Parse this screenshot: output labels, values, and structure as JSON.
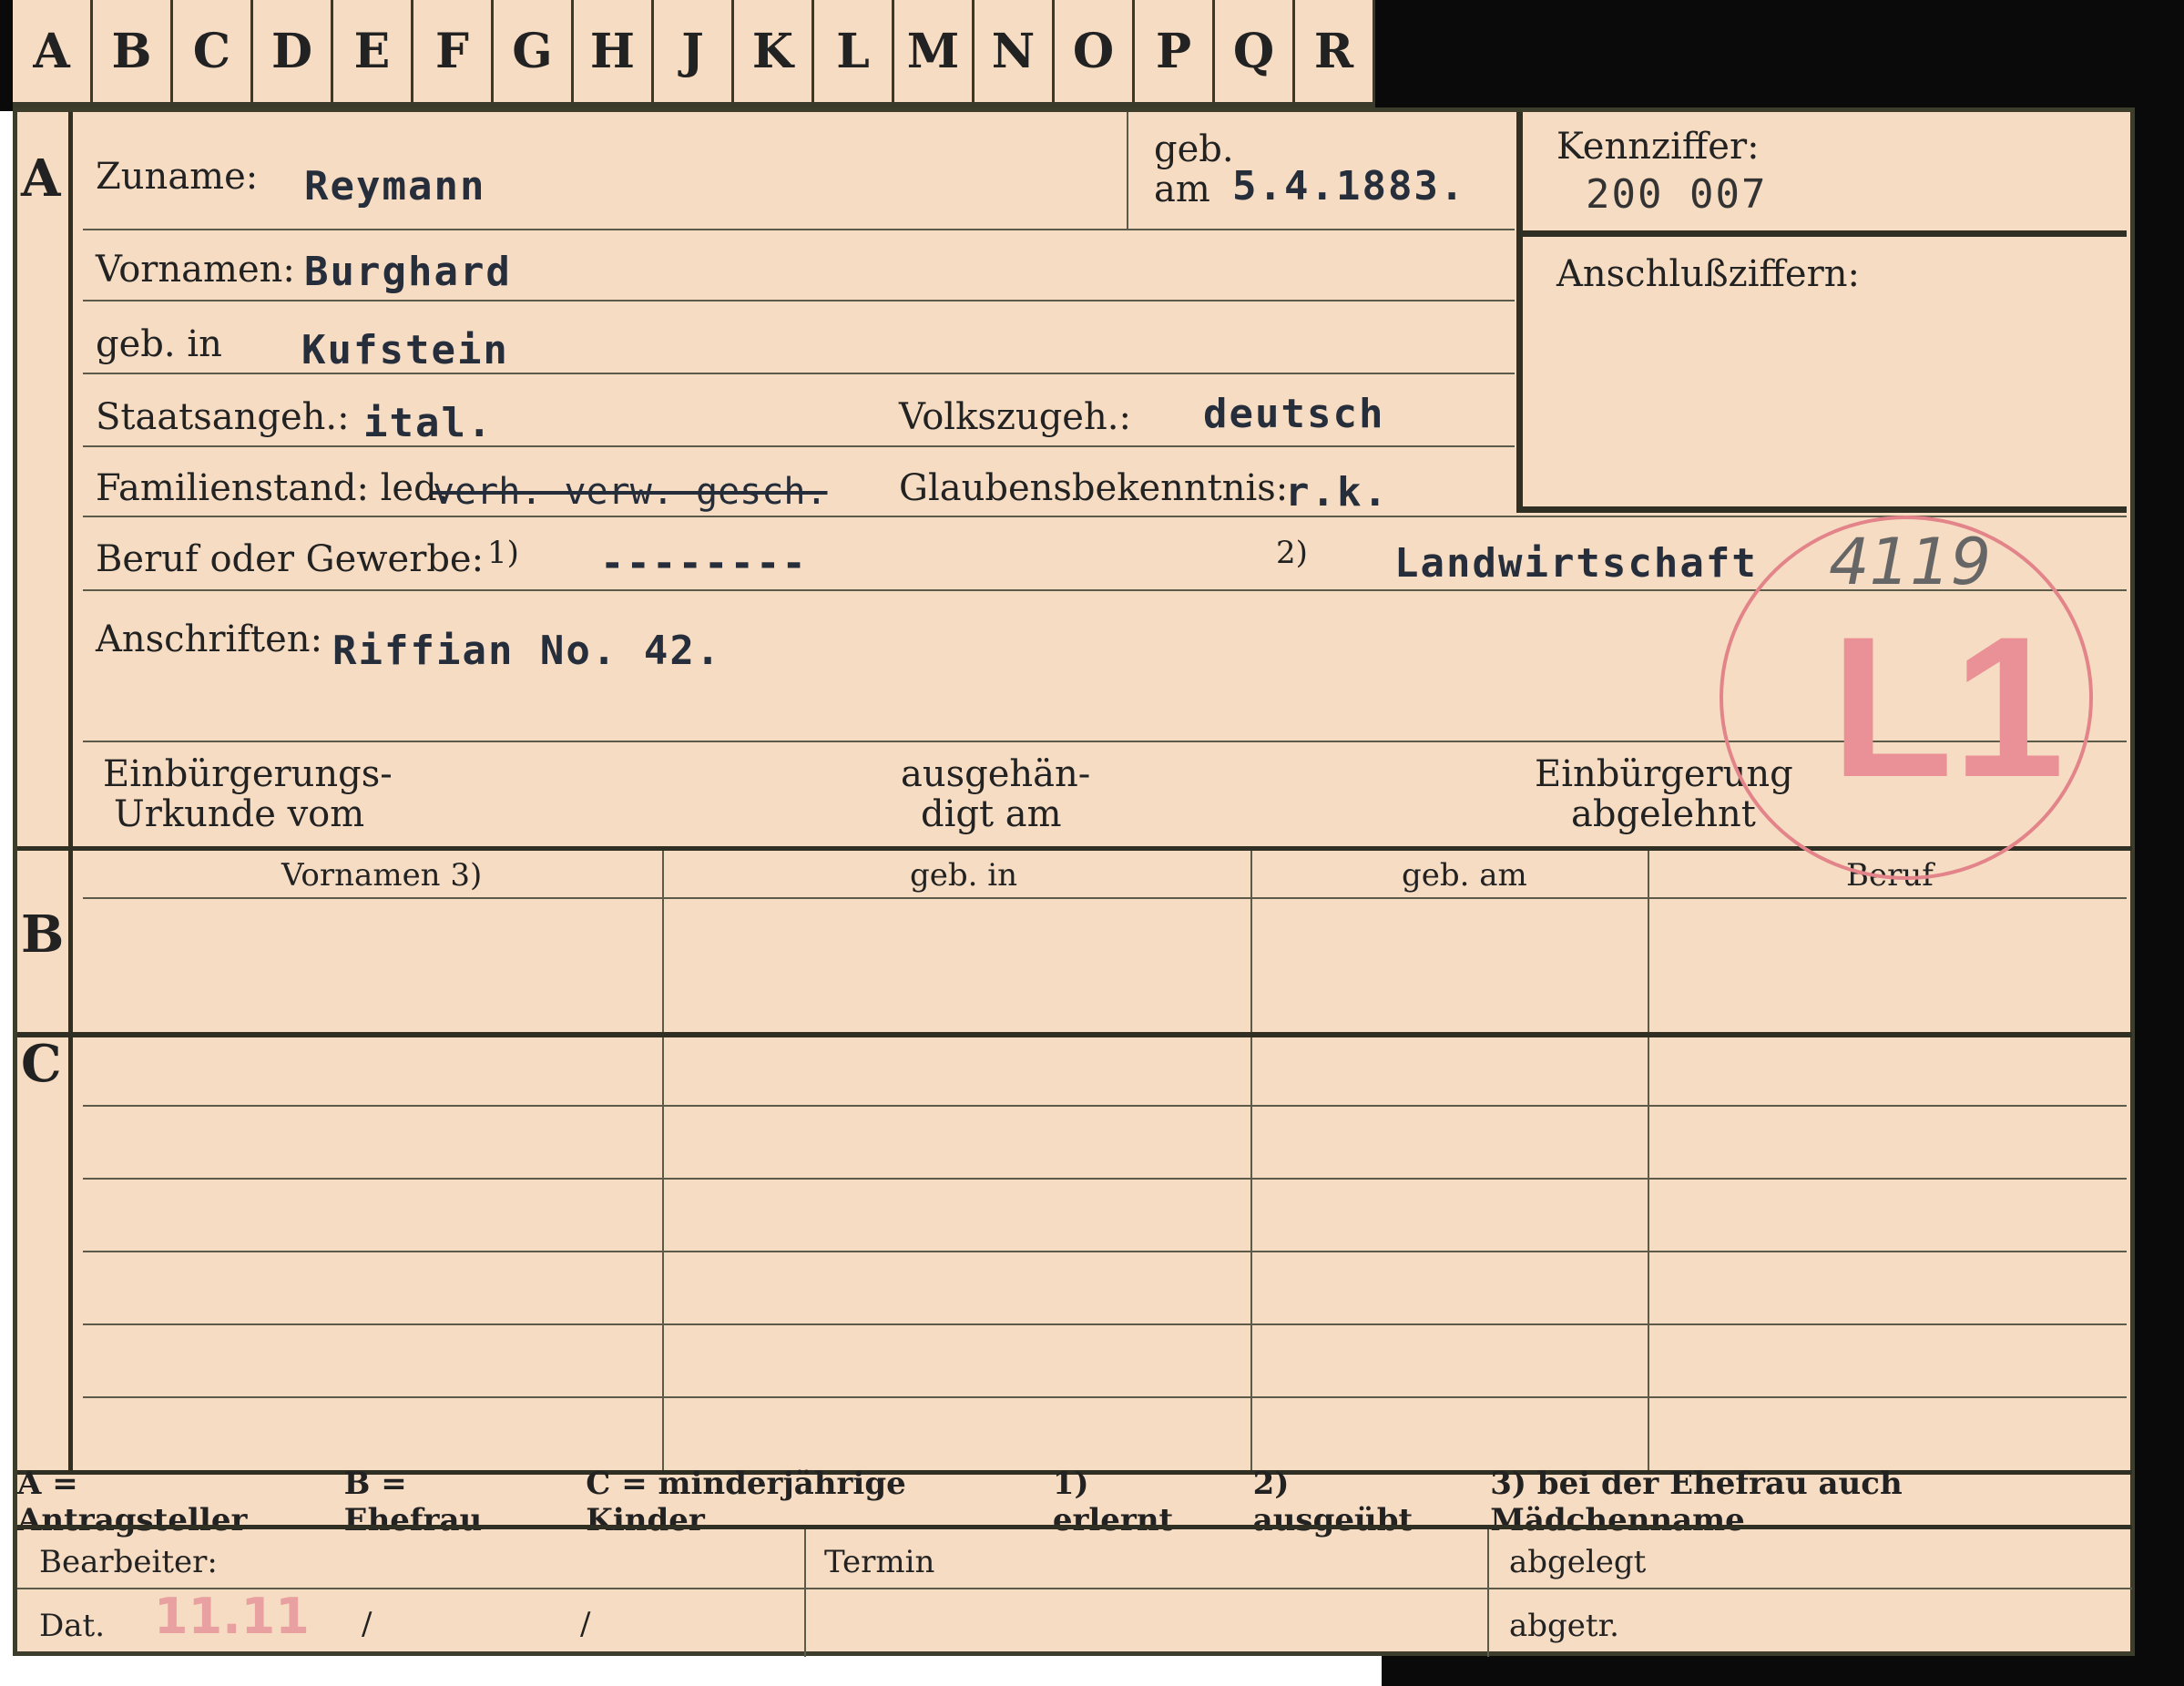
{
  "tabs": [
    "A",
    "B",
    "C",
    "D",
    "E",
    "F",
    "G",
    "H",
    "J",
    "K",
    "L",
    "M",
    "N",
    "O",
    "P",
    "Q",
    "R"
  ],
  "section_marks": {
    "a": "A",
    "b": "B",
    "c": "C"
  },
  "section_a": {
    "surname_label": "Zuname:",
    "surname_value": "Reymann",
    "born_label_1": "geb.",
    "born_label_2": "am",
    "born_value": "5.4.1883.",
    "first_names_label": "Vornamen:",
    "first_names_value": "Burghard",
    "birthplace_label": "geb. in",
    "birthplace_value": "Kufstein",
    "citizenship_label": "Staatsangeh.:",
    "citizenship_value": "ital.",
    "ethnicity_label": "Volkszugeh.:",
    "ethnicity_value": "deutsch",
    "marital_label": "Familienstand: led.",
    "marital_struck": "verh. verw. gesch.",
    "religion_label": "Glaubensbekenntnis:",
    "religion_value": "r.k.",
    "profession_label": "Beruf oder Gewerbe:",
    "profession_mark_1": "1)",
    "profession_value_1": "--------",
    "profession_mark_2": "2)",
    "profession_value_2": "Landwirtschaft",
    "address_label": "Anschriften:",
    "address_value": "Riffian No. 42.",
    "naturalization_label_1": "Einbürgerungs-",
    "naturalization_label_2": "Urkunde vom",
    "handed_label_1": "ausgehän-",
    "handed_label_2": "digt am",
    "rejected_label_1": "Einbürgerung",
    "rejected_label_2": "abgelehnt"
  },
  "id_box": {
    "kennziffer_label": "Kennziffer:",
    "kennziffer_value": "200 007",
    "anschluss_label": "Anschlußziffern:"
  },
  "stamp": {
    "text": "L1",
    "pencil_number": "4119"
  },
  "section_b": {
    "headers": [
      "Vornamen 3)",
      "geb. in",
      "geb. am",
      "Beruf"
    ]
  },
  "legend": [
    "A = Antragsteller",
    "B = Ehefrau",
    "C = minderjährige Kinder",
    "1) erlernt",
    "2) ausgeübt",
    "3) bei der Ehefrau auch Mädchenname"
  ],
  "footer": {
    "bearbeiter_label": "Bearbeiter:",
    "dat_label": "Dat.",
    "dat_value": "11.11",
    "dat_separators": [
      "/",
      "/"
    ],
    "termin_label": "Termin",
    "abgelegt_label": "abgelegt",
    "abgetr_label": "abgetr."
  }
}
